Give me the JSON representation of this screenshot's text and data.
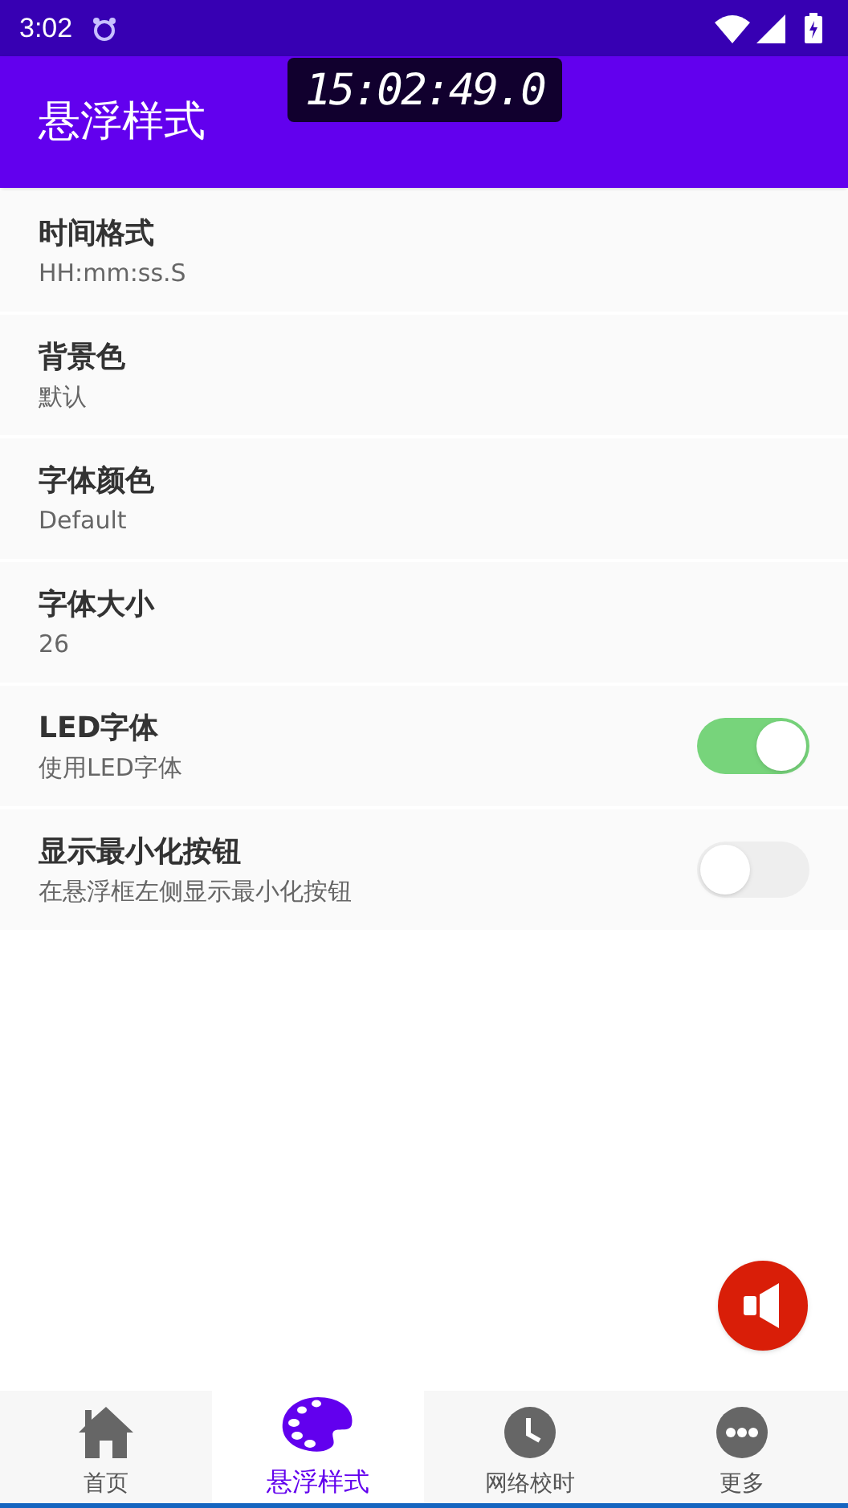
{
  "status_bar": {
    "time": "3:02"
  },
  "floating_clock": {
    "time": "15:02:49.0"
  },
  "app_bar": {
    "title": "悬浮样式"
  },
  "settings": [
    {
      "kind": "text",
      "title": "时间格式",
      "summary": "HH:mm:ss.S"
    },
    {
      "kind": "text",
      "title": "背景色",
      "summary": "默认"
    },
    {
      "kind": "text",
      "title": "字体颜色",
      "summary": "Default"
    },
    {
      "kind": "text",
      "title": "字体大小",
      "summary": "26"
    },
    {
      "kind": "switch",
      "title": "LED字体",
      "summary": "使用LED字体",
      "on": true
    },
    {
      "kind": "switch",
      "title": "显示最小化按钮",
      "summary": "在悬浮框左侧显示最小化按钮",
      "on": false
    }
  ],
  "bottom_nav": [
    {
      "label": "首页",
      "selected": false
    },
    {
      "label": "悬浮样式",
      "selected": true
    },
    {
      "label": "网络校时",
      "selected": false
    },
    {
      "label": "更多",
      "selected": false
    }
  ]
}
